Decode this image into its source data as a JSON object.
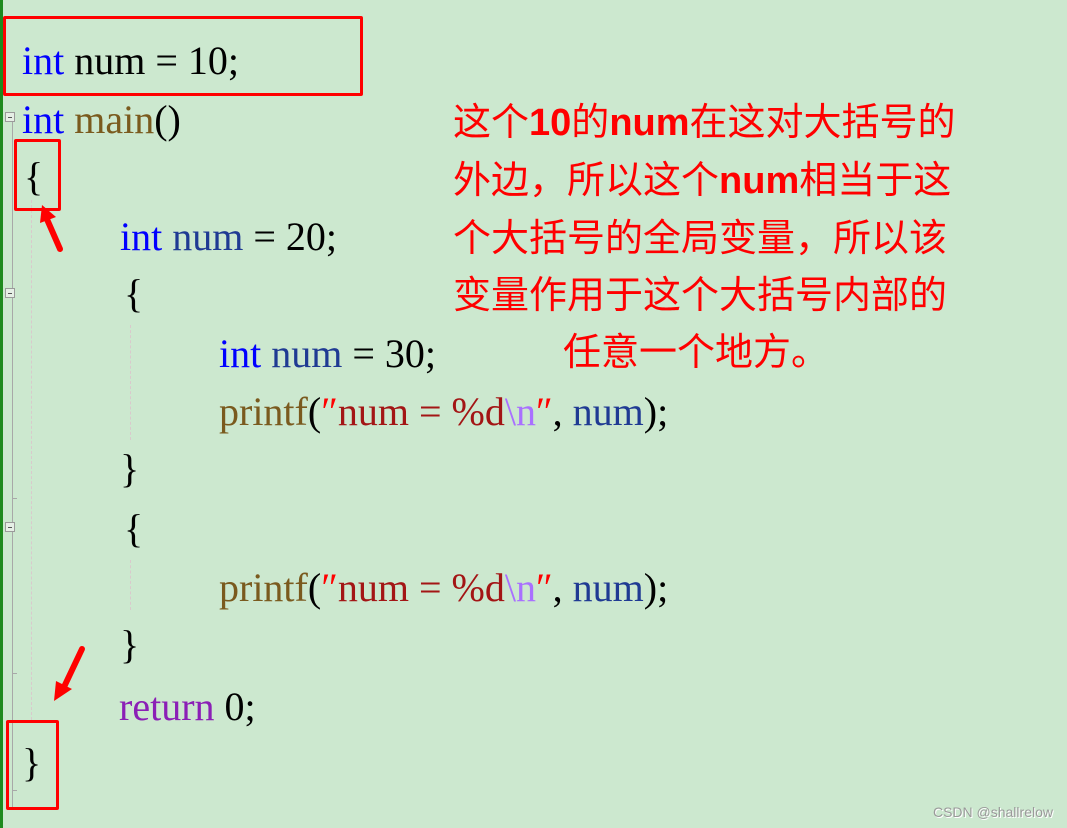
{
  "code": {
    "line1": {
      "kw": "int",
      "var": " num",
      "rest": " = 10;"
    },
    "line2": {
      "kw": "int",
      "fn": " main",
      "rest": "()"
    },
    "line3": {
      "text": "{"
    },
    "line4": {
      "kw": "int",
      "var": " num",
      "rest": " = 20;"
    },
    "line5": {
      "text": "{"
    },
    "line6": {
      "kw": "int",
      "var": " num",
      "rest": " = 30;"
    },
    "line7": {
      "fn": "printf",
      "paren": "(",
      "q1": "″",
      "str": "num = %d",
      "esc": "\\n",
      "q2": "″",
      "comma": ", ",
      "var": "num",
      "end": ");"
    },
    "line8": {
      "text": "}"
    },
    "line9": {
      "text": "{"
    },
    "line10": {
      "fn": "printf",
      "paren": "(",
      "q1": "″",
      "str": "num = %d",
      "esc": "\\n",
      "q2": "″",
      "comma": ", ",
      "var": "num",
      "end": ");"
    },
    "line11": {
      "text": "}"
    },
    "line12": {
      "ret": "return",
      "rest": " 0;"
    },
    "line13": {
      "text": "}"
    }
  },
  "annotation": {
    "line1": {
      "a": "这个",
      "b": "10",
      "c": "的",
      "d": "num",
      "e": "在这对大括号的"
    },
    "line2": {
      "a": "外边，所以这个",
      "b": "num",
      "c": "相当于这"
    },
    "line3": "个大括号的全局变量，所以该",
    "line4": "变量作用于这个大括号内部的",
    "line5": "任意一个地方。"
  },
  "icons": [
    "arrow-up-left-icon",
    "arrow-down-left-icon",
    "fold-collapse-icon"
  ],
  "colors": {
    "background": "#cce8cf",
    "highlight": "#ff0000",
    "keyword": "#0000ff"
  },
  "watermark": "CSDN @shallrelow"
}
